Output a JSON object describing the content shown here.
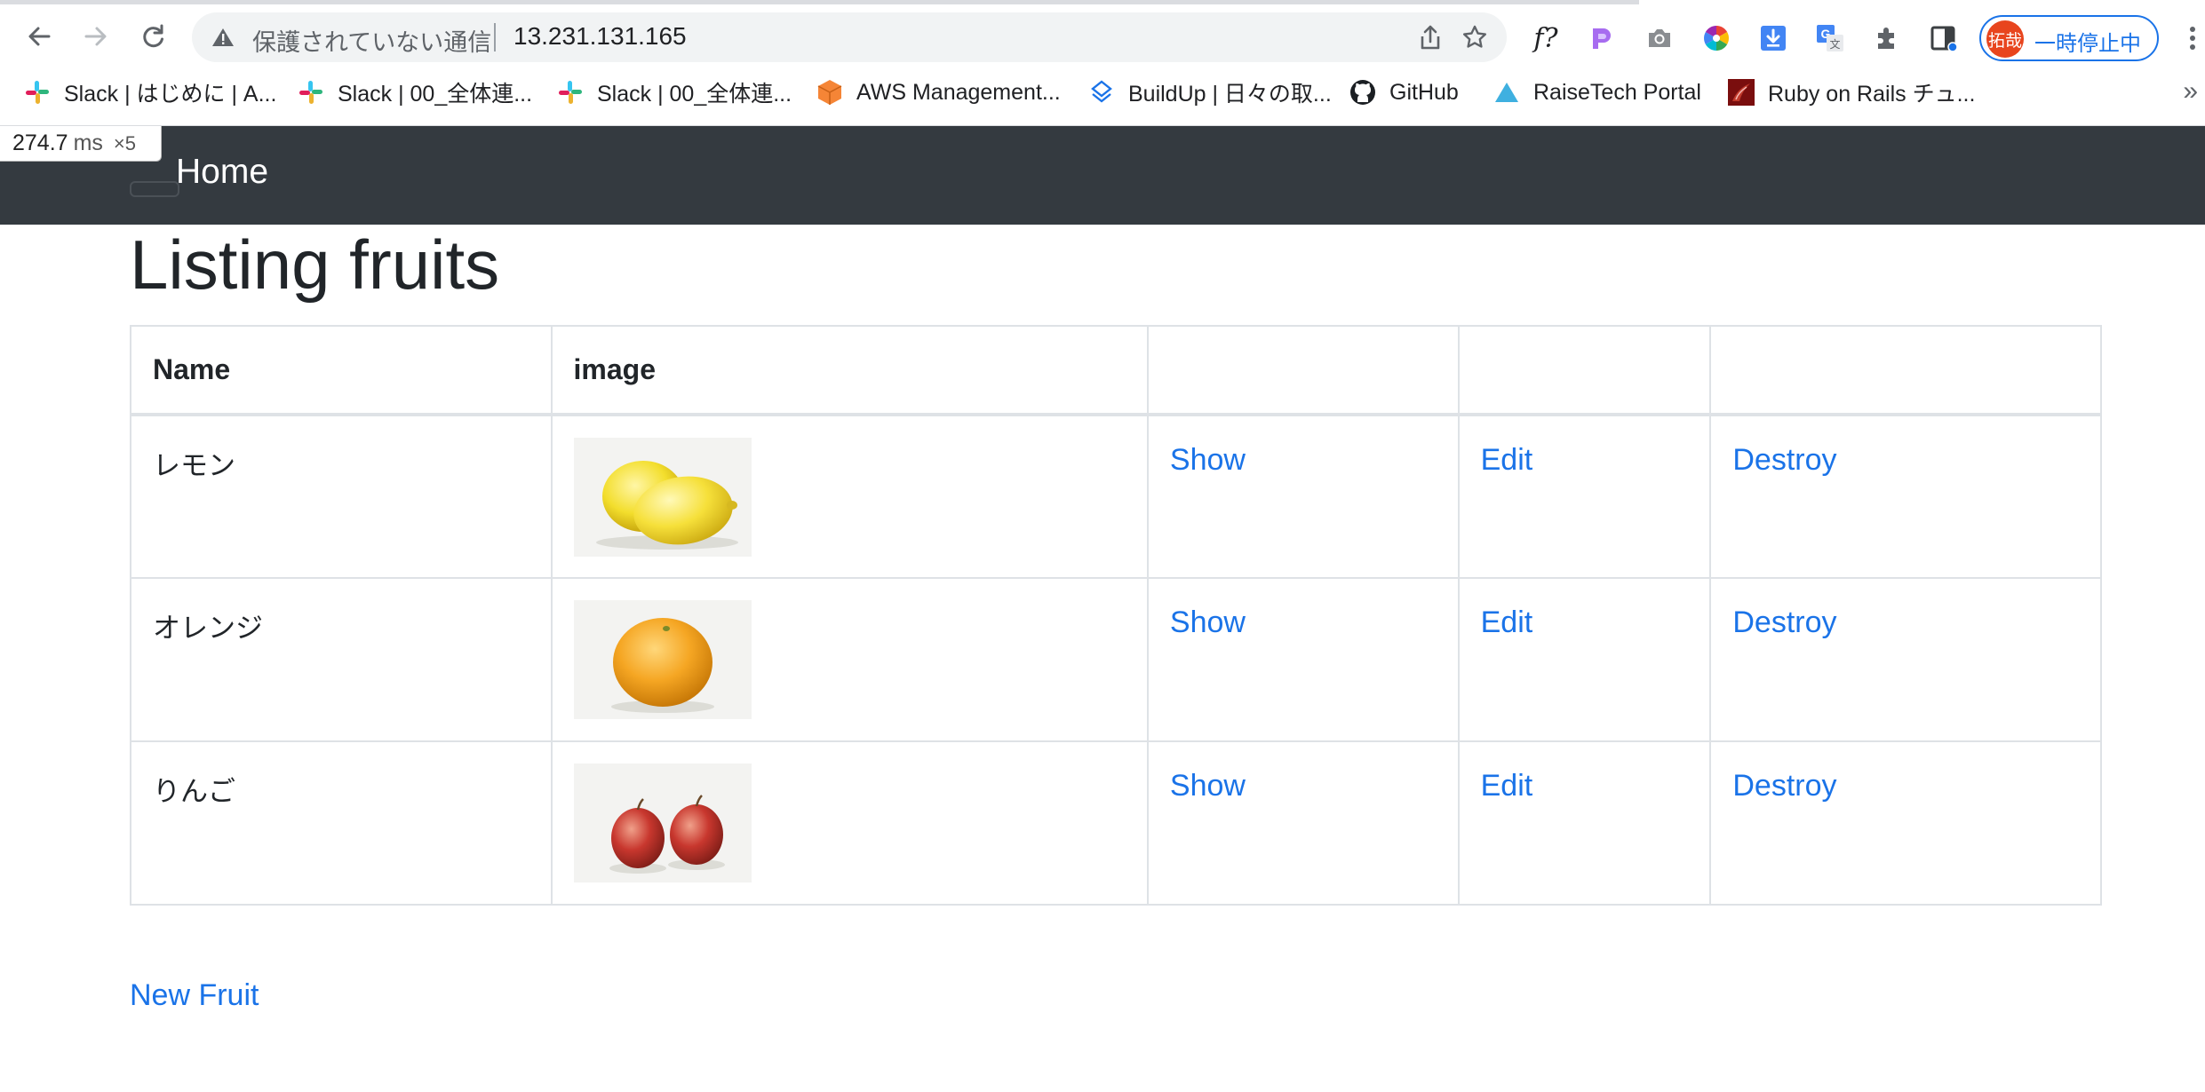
{
  "browser": {
    "security_status": "保護されていない通信",
    "url": "13.231.131.165",
    "profile": {
      "avatar_text": "拓哉",
      "label": "一時停止中"
    },
    "bookmarks": [
      {
        "label": "Slack | はじめに | A...",
        "icon": "slack-icon"
      },
      {
        "label": "Slack | 00_全体連...",
        "icon": "slack-icon"
      },
      {
        "label": "Slack | 00_全体連...",
        "icon": "slack-icon"
      },
      {
        "label": "AWS Management...",
        "icon": "aws-icon"
      },
      {
        "label": "BuildUp | 日々の取...",
        "icon": "buildup-icon"
      },
      {
        "label": "GitHub",
        "icon": "github-icon"
      },
      {
        "label": "RaiseTech Portal",
        "icon": "raisetech-icon"
      },
      {
        "label": "Ruby on Rails チュ...",
        "icon": "rails-icon"
      }
    ],
    "bookmarks_more": "»"
  },
  "perf_badge": {
    "value": "274.7",
    "unit": "ms",
    "count": "×5"
  },
  "navbar": {
    "brand": "Home"
  },
  "page": {
    "title": "Listing fruits",
    "columns": [
      "Name",
      "image",
      "",
      "",
      ""
    ],
    "rows": [
      {
        "name": "レモン",
        "image": "lemon",
        "show": "Show",
        "edit": "Edit",
        "destroy": "Destroy"
      },
      {
        "name": "オレンジ",
        "image": "orange",
        "show": "Show",
        "edit": "Edit",
        "destroy": "Destroy"
      },
      {
        "name": "りんご",
        "image": "apple",
        "show": "Show",
        "edit": "Edit",
        "destroy": "Destroy"
      }
    ],
    "new_link": "New Fruit"
  },
  "colors": {
    "navbar_bg": "#343a40",
    "link": "#1a73e8",
    "table_border": "#dee2e6"
  }
}
